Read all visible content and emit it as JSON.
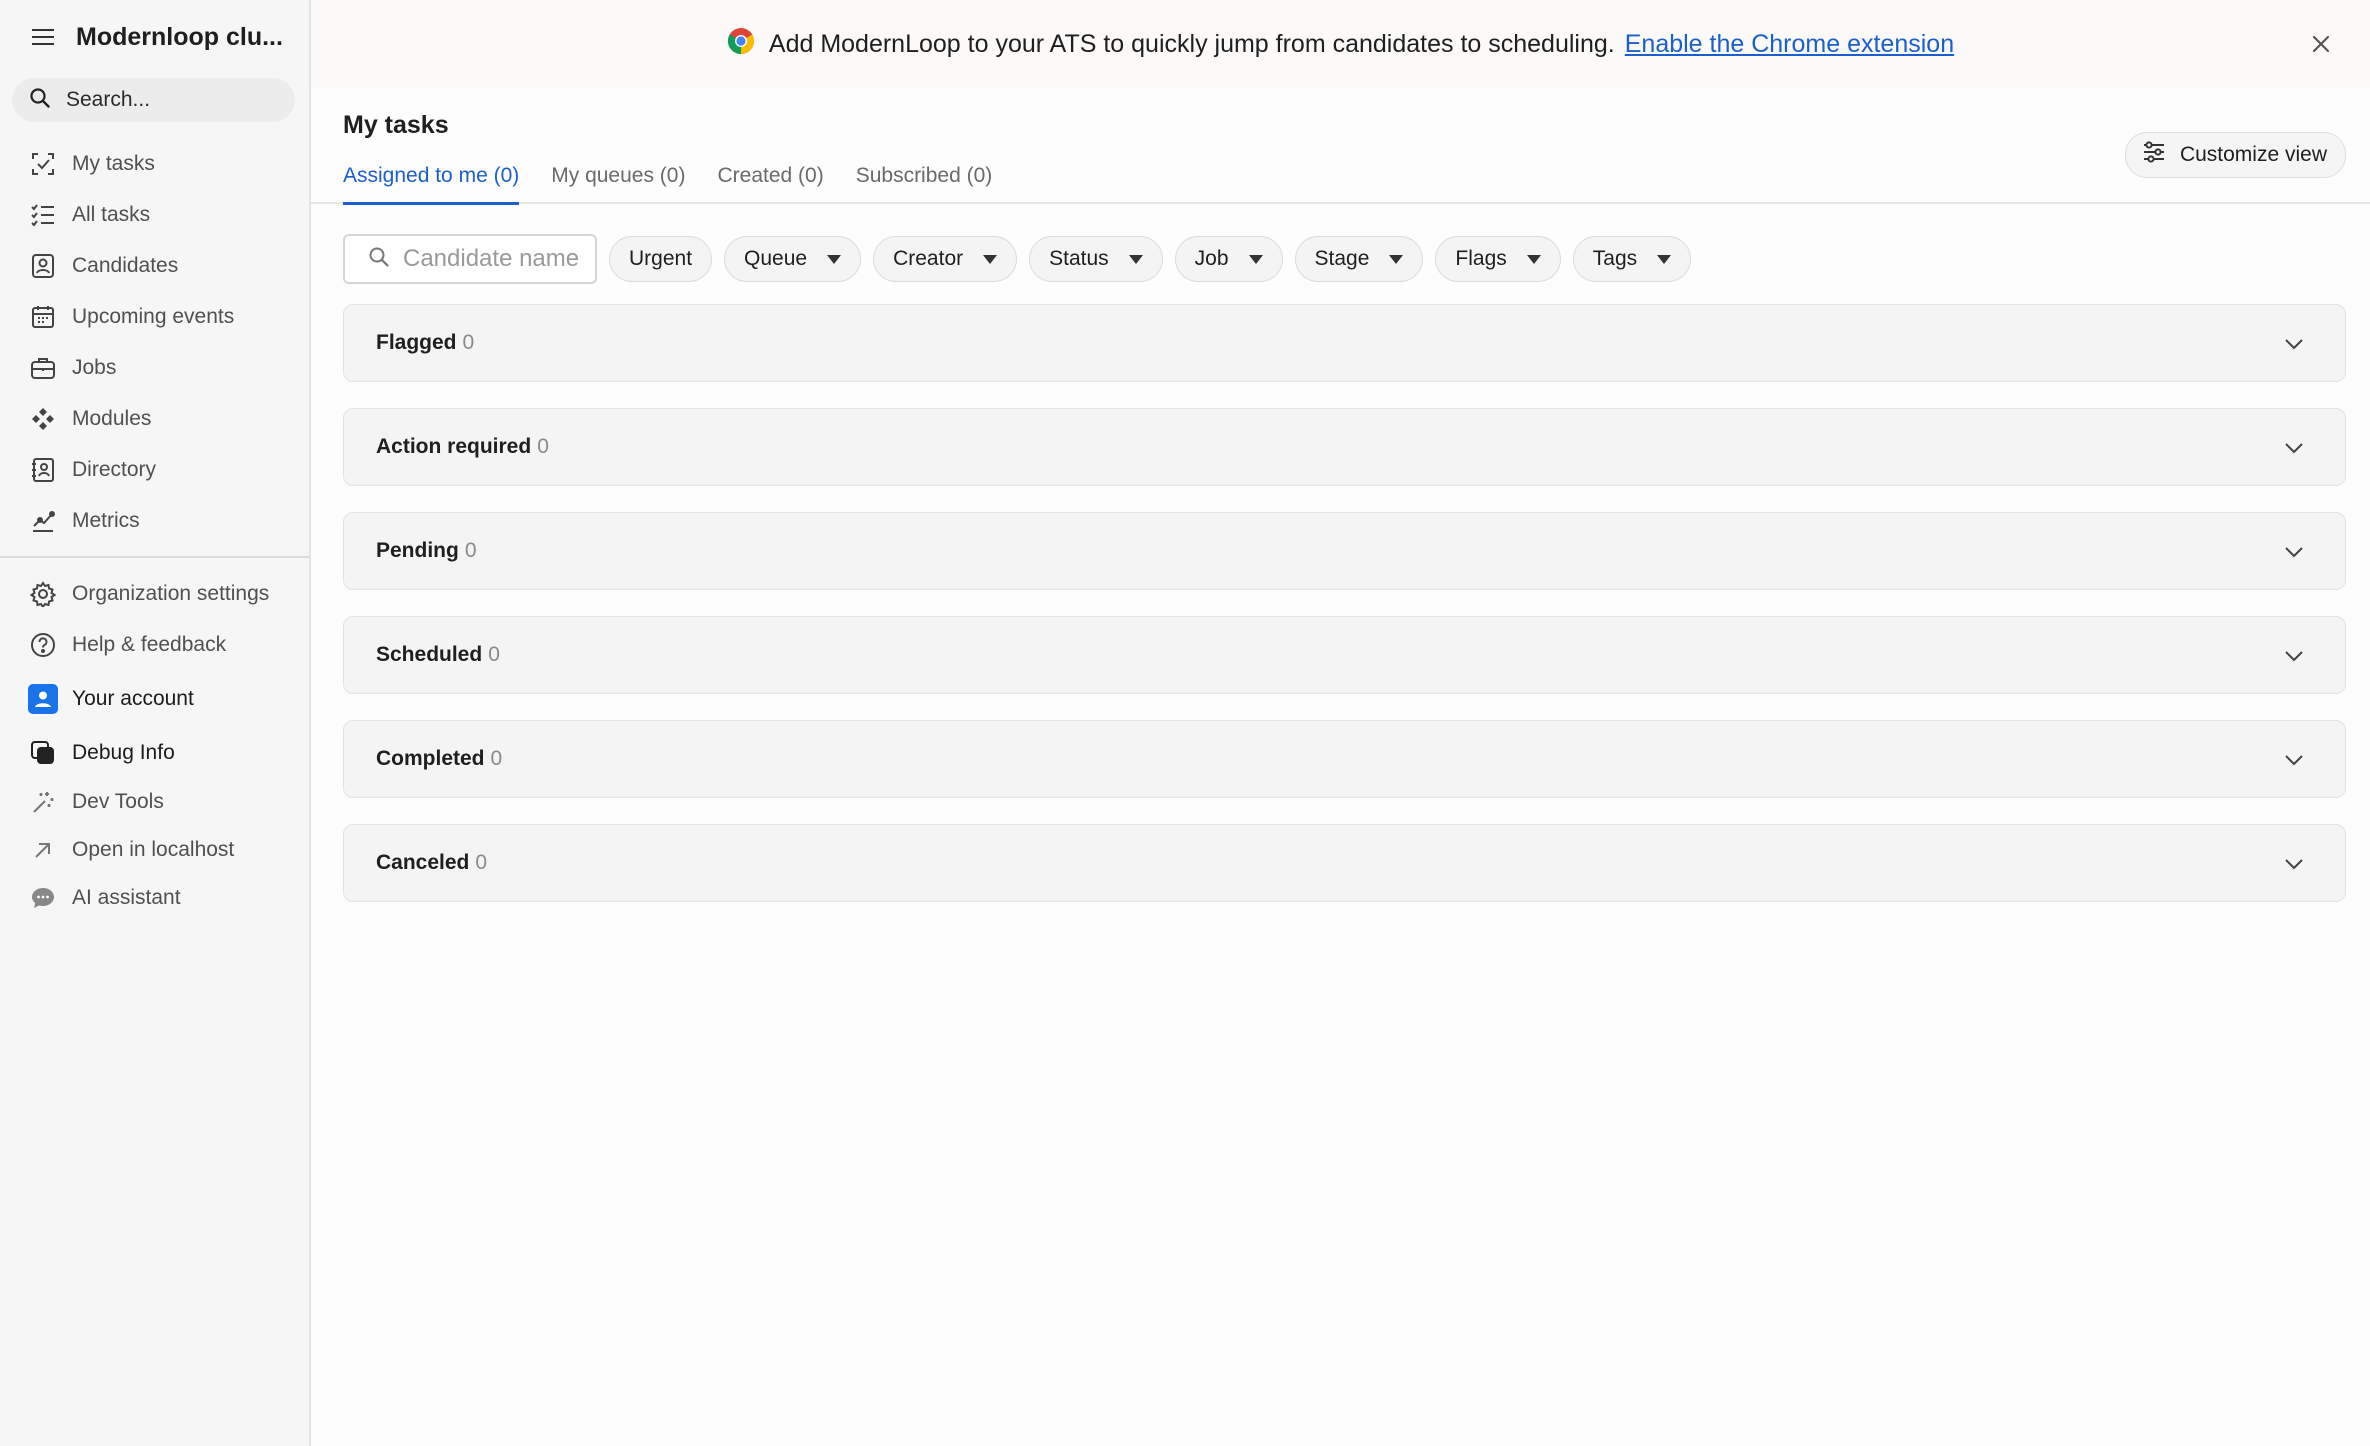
{
  "sidebar": {
    "org_name": "Modernloop clu...",
    "search_label": "Search...",
    "nav": [
      {
        "label": "My tasks",
        "icon": "my-tasks-icon"
      },
      {
        "label": "All tasks",
        "icon": "list-check-icon"
      },
      {
        "label": "Candidates",
        "icon": "candidate-icon"
      },
      {
        "label": "Upcoming events",
        "icon": "calendar-icon"
      },
      {
        "label": "Jobs",
        "icon": "briefcase-icon"
      },
      {
        "label": "Modules",
        "icon": "modules-icon"
      },
      {
        "label": "Directory",
        "icon": "directory-icon"
      },
      {
        "label": "Metrics",
        "icon": "metrics-icon"
      }
    ],
    "secondary": [
      {
        "label": "Organization settings",
        "icon": "gear-icon"
      },
      {
        "label": "Help & feedback",
        "icon": "help-icon"
      },
      {
        "label": "Your account",
        "icon": "account-icon"
      },
      {
        "label": "Debug Info",
        "icon": "debug-icon"
      },
      {
        "label": "Dev Tools",
        "icon": "magic-wand-icon"
      },
      {
        "label": "Open in localhost",
        "icon": "arrow-up-right-icon"
      },
      {
        "label": "AI assistant",
        "icon": "chat-bubble-icon"
      }
    ]
  },
  "banner": {
    "message": "Add ModernLoop to your ATS to quickly jump from candidates to scheduling.",
    "link": "Enable the Chrome extension"
  },
  "page": {
    "title": "My tasks",
    "customize_label": "Customize view",
    "tabs": [
      {
        "label": "Assigned to me (0)",
        "active": true
      },
      {
        "label": "My queues (0)",
        "active": false
      },
      {
        "label": "Created (0)",
        "active": false
      },
      {
        "label": "Subscribed (0)",
        "active": false
      }
    ]
  },
  "filters": {
    "search_placeholder": "Candidate name",
    "chips": [
      "Urgent",
      "Queue",
      "Creator",
      "Status",
      "Job",
      "Stage",
      "Flags",
      "Tags"
    ]
  },
  "groups": [
    {
      "label": "Flagged",
      "count": "0"
    },
    {
      "label": "Action required",
      "count": "0"
    },
    {
      "label": "Pending",
      "count": "0"
    },
    {
      "label": "Scheduled",
      "count": "0"
    },
    {
      "label": "Completed",
      "count": "0"
    },
    {
      "label": "Canceled",
      "count": "0"
    }
  ],
  "colors": {
    "accent": "#1a5fcc",
    "account_badge": "#1a73e8"
  }
}
